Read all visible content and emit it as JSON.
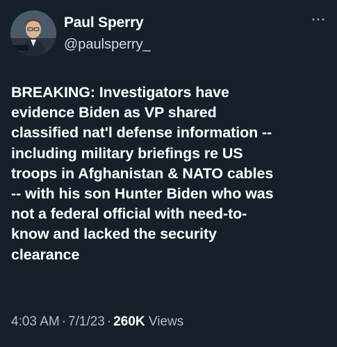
{
  "author": {
    "display_name": "Paul Sperry",
    "handle": "@paulsperry_"
  },
  "icons": {
    "more": "more-horizontal-icon",
    "avatar": "profile-photo"
  },
  "tweet": {
    "text": "BREAKING: Investigators have\nevidence Biden as VP shared\nclassified nat'l defense information --\nincluding military briefings re US\ntroops in Afghanistan & NATO cables\n-- with his son Hunter Biden who was\nnot a federal official with need-to-\nknow and lacked the security\nclearance"
  },
  "meta": {
    "time": "4:03 AM",
    "separator": "·",
    "date": "7/1/23",
    "views_count": "260K",
    "views_label": "Views"
  },
  "colors": {
    "background": "#15202b",
    "text_primary": "#ffffff",
    "text_secondary": "#b3bcc6"
  }
}
